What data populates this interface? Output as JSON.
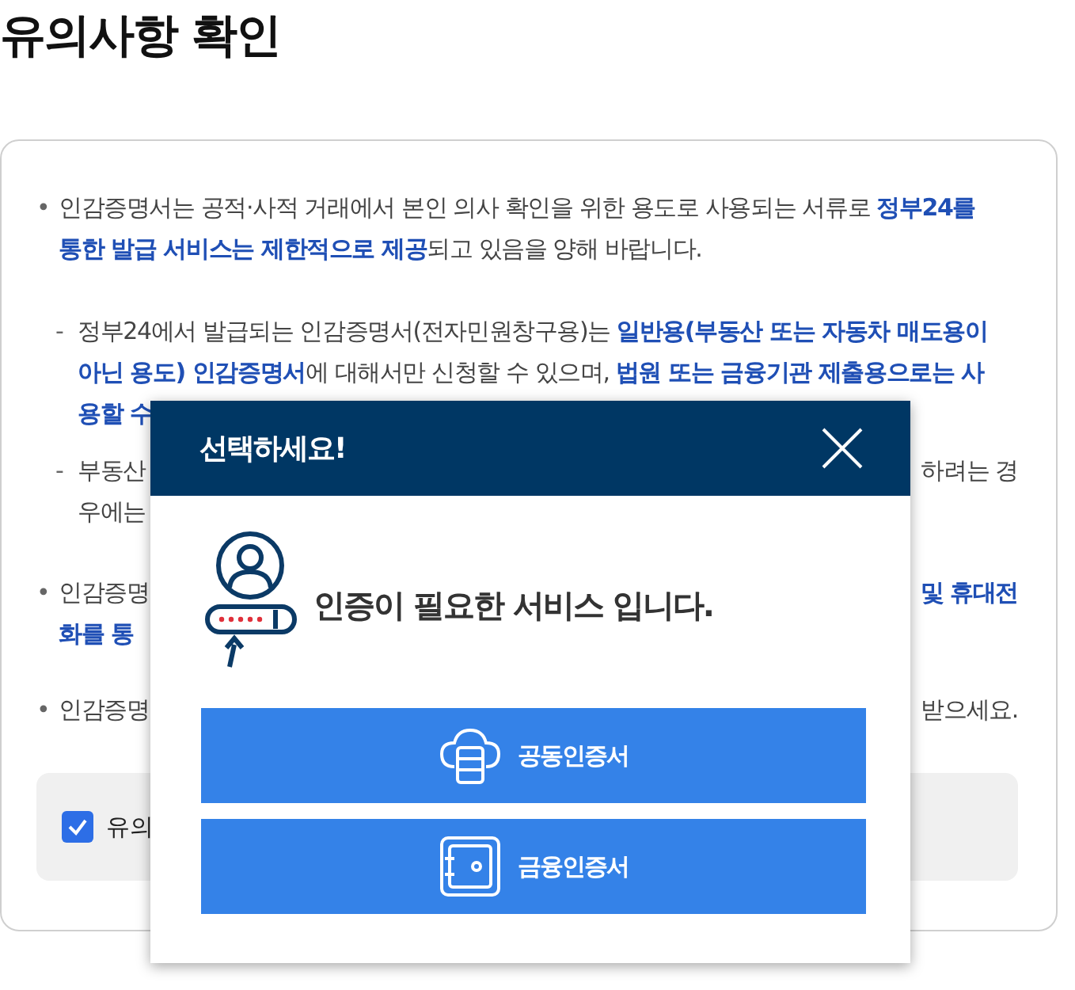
{
  "page_title": "유의사항 확인",
  "notices": [
    {
      "marker": "•",
      "indented": false,
      "lines": [
        {
          "left": "인감증명서는 공적·사적 거래에서 본인 의사 확인을 위한 용도로 사용되는 서류로 **정부24를**"
        },
        {
          "left": "**통한 발급 서비스는 제한적으로 제공**되고 있음을 양해 바랍니다."
        }
      ]
    },
    {
      "marker": "-",
      "indented": true,
      "lines": [
        {
          "left": "정부24에서 발급되는 인감증명서(전자민원창구용)는 **일반용(부동산 또는 자동차 매도용이**"
        },
        {
          "left": "**아닌 용도) 인감증명서**에 대해서만 신청할 수 있으며, **법원 또는 금융기관 제출용으로는 사**"
        },
        {
          "left": "**용할 수**"
        }
      ]
    },
    {
      "marker": "-",
      "indented": true,
      "lines": [
        {
          "left": "부동산",
          "right": "하려는 경"
        },
        {
          "left": "우에는"
        }
      ]
    },
    {
      "marker": "•",
      "indented": false,
      "lines": [
        {
          "left": "인감증명",
          "right": "**및 휴대전**"
        },
        {
          "left": "**화를 통**"
        }
      ]
    },
    {
      "marker": "•",
      "indented": false,
      "lines": [
        {
          "left": "인감증명",
          "right": "받으세요."
        }
      ]
    }
  ],
  "agreement": {
    "checked": true,
    "label": "유의"
  },
  "modal": {
    "title": "선택하세요!",
    "message": "인증이 필요한 서비스 입니다.",
    "buttons": [
      {
        "kind": "cloud",
        "label": "공동인증서"
      },
      {
        "kind": "safe",
        "label": "금융인증서"
      }
    ]
  }
}
